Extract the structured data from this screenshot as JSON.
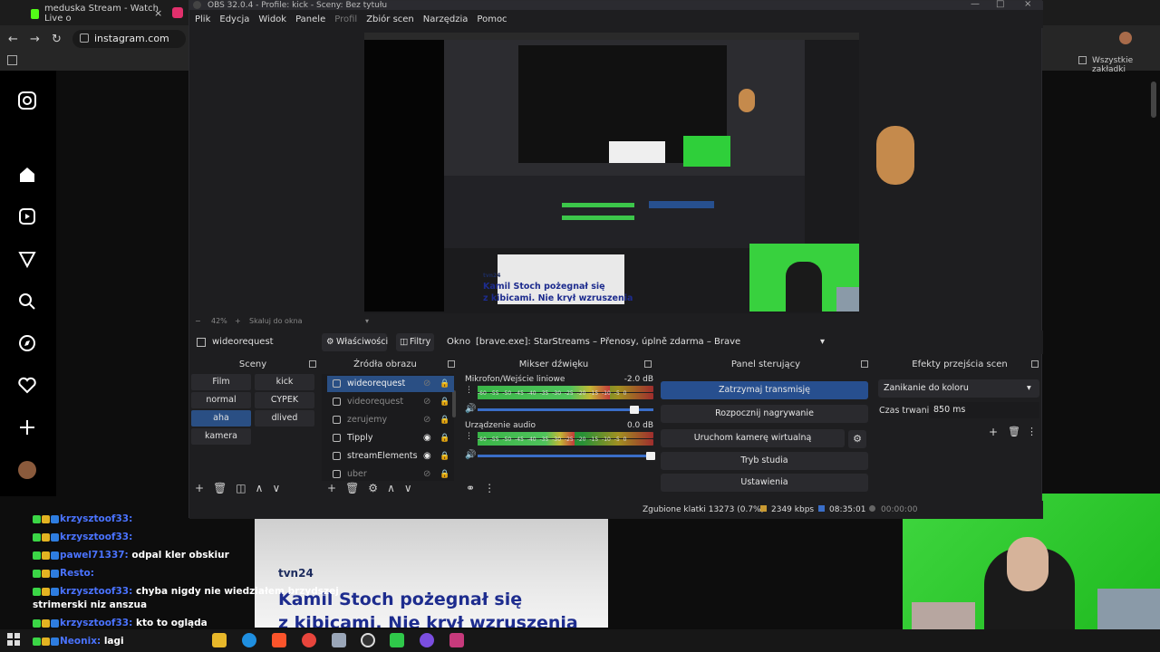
{
  "browser": {
    "tabs": [
      {
        "label": "meduska Stream - Watch Live o",
        "icon": "kick-icon",
        "color": "#53fc18"
      },
      {
        "label": "",
        "icon": "instagram-icon",
        "color": "#e1306c"
      }
    ],
    "url": "instagram.com",
    "bookmarks_label": "Wszystkie zakładki"
  },
  "obs": {
    "title": "OBS 32.0.4 - Profile: kick - Sceny: Bez tytułu",
    "menu": [
      "Plik",
      "Edycja",
      "Widok",
      "Panele",
      "Profil",
      "Zbiór scen",
      "Narzędzia",
      "Pomoc"
    ],
    "zoom": "42%",
    "zoom_fit": "Skaluj do okna",
    "source_name": "wideorequest",
    "props_label": "Właściwości",
    "filters_label": "Filtry",
    "window_label": "Okno",
    "window_value": "[brave.exe]: StarStreams – Přenosy, úplně zdarma – Brave",
    "docks": {
      "scenes": "Sceny",
      "sources": "Źródła obrazu",
      "mixer": "Mikser dźwięku",
      "controls": "Panel sterujący",
      "transitions": "Efekty przejścia scen"
    },
    "scenes": [
      "Film",
      "kick",
      "normal",
      "CYPEK",
      "aha",
      "dlived",
      "kamera"
    ],
    "active_scene": "aha",
    "sources": [
      {
        "name": "wideorequest",
        "visible": false
      },
      {
        "name": "videorequest",
        "visible": false
      },
      {
        "name": "zerujemy",
        "visible": false
      },
      {
        "name": "Tipply",
        "visible": true
      },
      {
        "name": "streamElements",
        "visible": true
      },
      {
        "name": "uber",
        "visible": false
      }
    ],
    "mixer": [
      {
        "name": "Mikrofon/Wejście liniowe",
        "db": "-2.0 dB",
        "level": 0.75
      },
      {
        "name": "Urządzenie audio",
        "db": "0.0 dB",
        "level": 0.55
      }
    ],
    "meter_ticks": "-60 -55 -50 -45 -40 -35 -30 -25 -20 -15 -10 -5 0",
    "controls": [
      "Zatrzymaj transmisję",
      "Rozpocznij nagrywanie",
      "Uruchom kamerę wirtualną",
      "Tryb studia",
      "Ustawienia"
    ],
    "transition": "Zanikanie do koloru",
    "duration_label": "Czas trwania",
    "duration_value": "850 ms",
    "status": {
      "dropped": "Zgubione klatki 13273 (0.7%)",
      "bitrate": "2349 kbps",
      "stream_time": "08:35:01",
      "rec_time": "00:00:00"
    }
  },
  "preview": {
    "news_brand": "tvn24",
    "headline_1": "Kamil Stoch pożegnał się",
    "headline_2": "z kibicami. Nie krył wzruszenia"
  },
  "chat": [
    {
      "user": "krzysztoof33:",
      "text": ""
    },
    {
      "user": "krzysztoof33:",
      "text": ""
    },
    {
      "user": "pawel71337:",
      "text": "odpal kler obskiur"
    },
    {
      "user": "Resto:",
      "text": ""
    },
    {
      "user": "krzysztoof33:",
      "text": "chyba nigdy nie wiedziałem brzydszej"
    },
    {
      "user": "",
      "text": "strimerski niz anszua"
    },
    {
      "user": "krzysztoof33:",
      "text": "kto to ogląda"
    },
    {
      "user": "Neonix:",
      "text": "lagi"
    }
  ],
  "stream_news": {
    "brand": "tvn24",
    "headline_1": "Kamil Stoch pożegnał się",
    "headline_2": "z kibicami. Nie krył wzruszenia"
  }
}
